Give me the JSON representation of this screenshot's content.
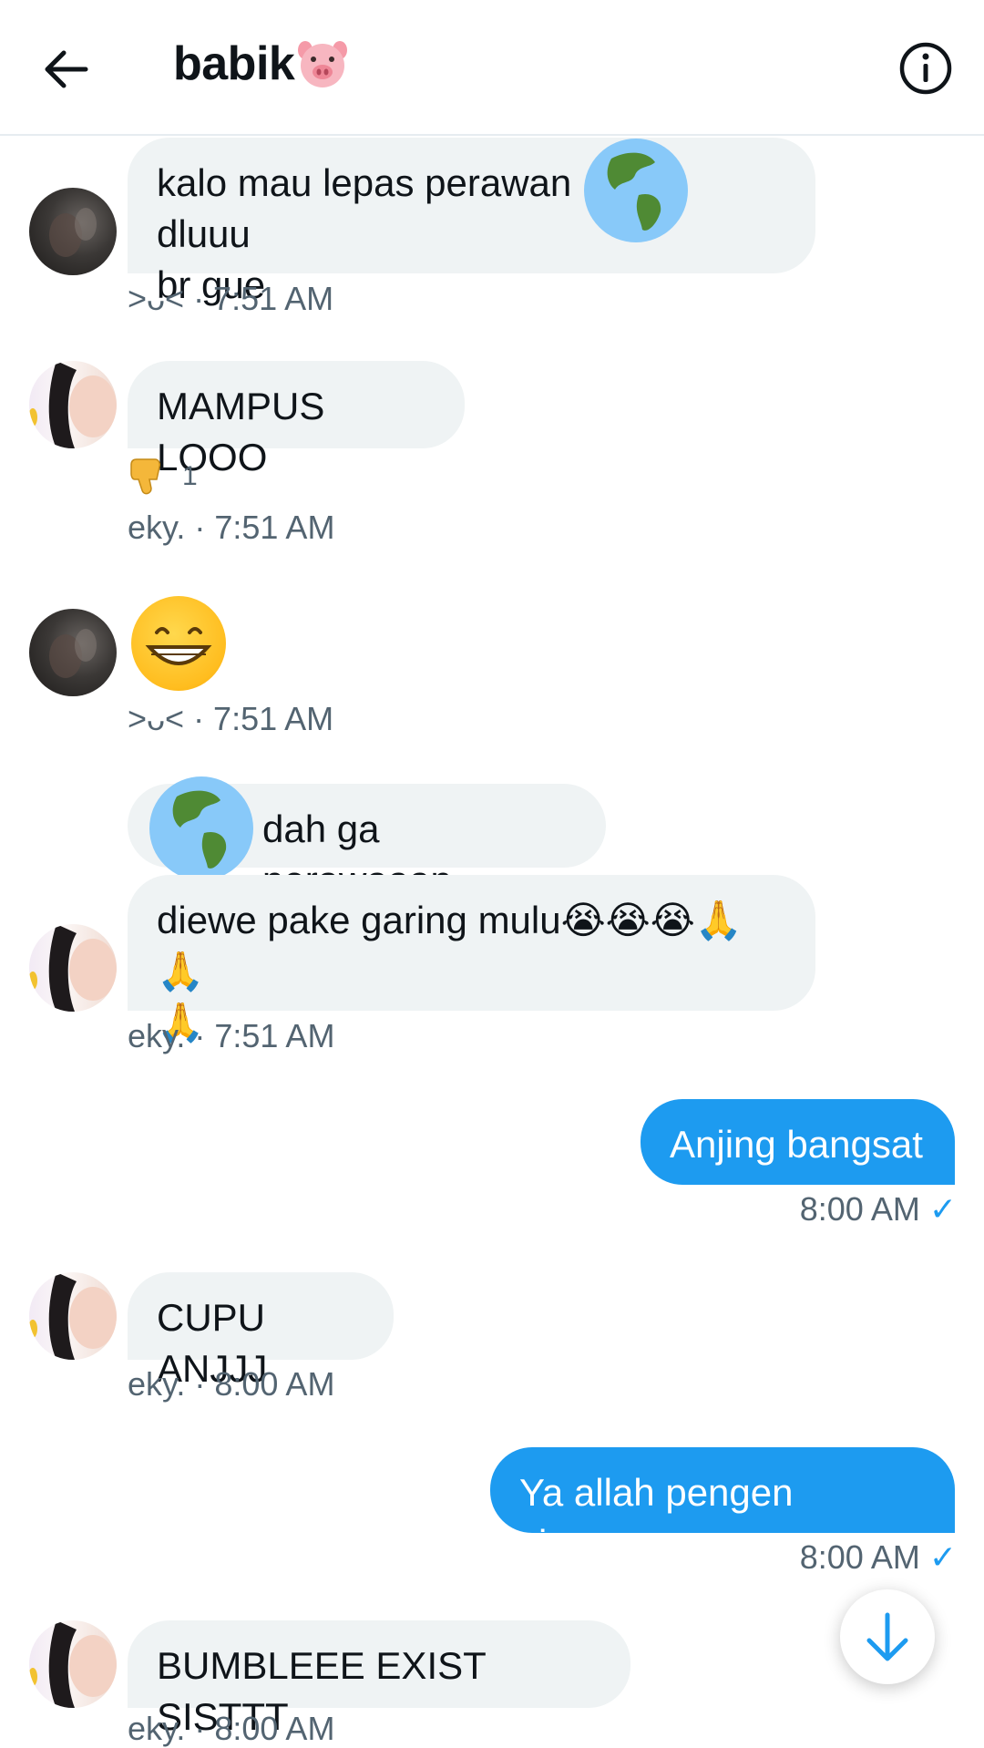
{
  "header": {
    "title": "babik",
    "title_emoji": "pig-face-emoji"
  },
  "messages": [
    {
      "sender": "avatar-dark",
      "text_line1": "kalo mau lepas perawan",
      "text_line1b": "dluuu",
      "text_line2": "br gue",
      "meta": ">ᴗ< · 7:51 AM"
    },
    {
      "sender": "avatar-light",
      "text": "MAMPUS LOOO",
      "reaction_count": "1",
      "meta": "eky. · 7:51 AM"
    },
    {
      "sender": "avatar-dark",
      "emoji": "grinning-face",
      "meta": ">ᴗ< · 7:51 AM"
    },
    {
      "sender": "avatar-light",
      "text_top": "dah ga perawaaan",
      "text_bottom_line1": "diewe pake garing mulu😭😭😭🙏🙏",
      "text_bottom_line2": "🙏",
      "meta": "eky. · 7:51 AM"
    },
    {
      "sender": "me",
      "text": "Anjing bangsat",
      "meta": "8:00 AM"
    },
    {
      "sender": "avatar-light",
      "text": "CUPU ANJJJ",
      "meta": "eky. · 8:00 AM"
    },
    {
      "sender": "me",
      "text": "Ya allah pengen ciuman",
      "meta": "8:00 AM"
    },
    {
      "sender": "avatar-light",
      "text": "BUMBLEEE EXIST SISTTT",
      "meta": "eky. · 8:00 AM"
    }
  ],
  "colors": {
    "accent": "#1d9bf0",
    "bubble_other": "#eff3f4",
    "meta": "#536471"
  }
}
